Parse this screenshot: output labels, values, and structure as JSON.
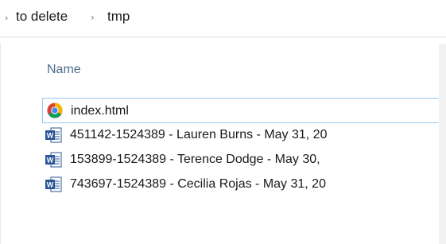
{
  "breadcrumb": {
    "segments": [
      {
        "label": "to delete"
      },
      {
        "label": "tmp"
      }
    ],
    "separator": "›",
    "edge_glyph": "›"
  },
  "columns": {
    "name_header": "Name"
  },
  "files": [
    {
      "name": "index.html",
      "icon": "chrome-icon",
      "focused": true
    },
    {
      "name": "451142-1524389 - Lauren Burns - May 31, 20",
      "icon": "word-doc-icon",
      "focused": false
    },
    {
      "name": "153899-1524389 - Terence Dodge - May 30,",
      "icon": "word-doc-icon",
      "focused": false
    },
    {
      "name": "743697-1524389 - Cecilia Rojas - May 31, 20",
      "icon": "word-doc-icon",
      "focused": false
    }
  ],
  "colors": {
    "header_text": "#4d6b8a",
    "focus_border": "#99c9ef",
    "word_blue": "#2b5797",
    "chrome_red": "#db4437",
    "chrome_yellow": "#f4b400",
    "chrome_green": "#0f9d58",
    "chrome_blue": "#4285f4"
  }
}
